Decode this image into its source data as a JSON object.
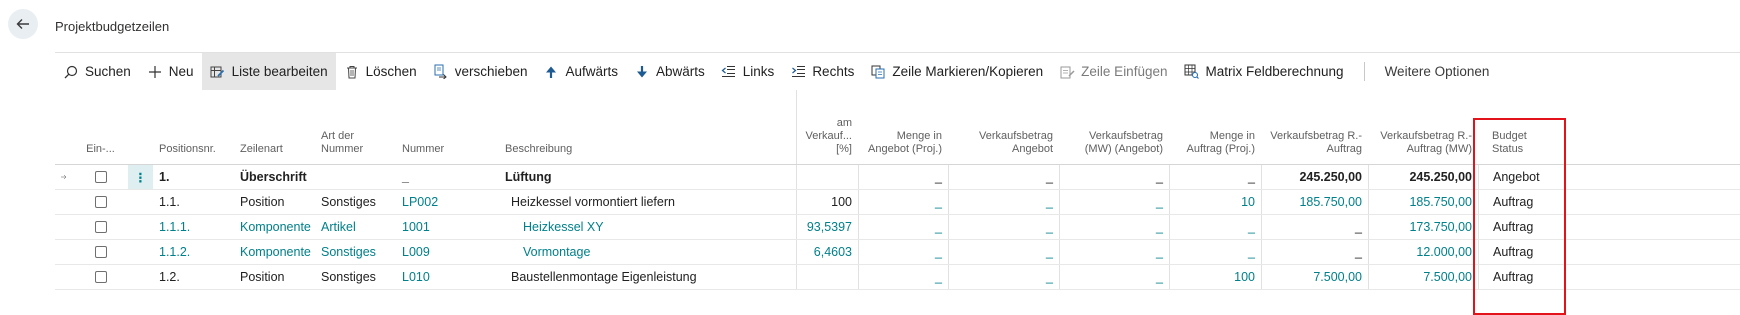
{
  "header": {
    "title": "Projektbudgetzeilen"
  },
  "toolbar": {
    "items": [
      {
        "label": "Suchen",
        "icon": "search-icon"
      },
      {
        "label": "Neu",
        "icon": "plus-icon"
      },
      {
        "label": "Liste bearbeiten",
        "icon": "edit-list-icon",
        "active": true
      },
      {
        "label": "Löschen",
        "icon": "trash-icon"
      },
      {
        "label": "verschieben",
        "icon": "move-icon"
      },
      {
        "label": "Aufwärts",
        "icon": "arrow-up-icon"
      },
      {
        "label": "Abwärts",
        "icon": "arrow-down-icon"
      },
      {
        "label": "Links",
        "icon": "outdent-icon"
      },
      {
        "label": "Rechts",
        "icon": "indent-icon"
      },
      {
        "label": "Zeile Markieren/Kopieren",
        "icon": "copy-icon"
      },
      {
        "label": "Zeile Einfügen",
        "icon": "paste-icon",
        "disabled": true
      },
      {
        "label": "Matrix Feldberechnung",
        "icon": "matrix-icon"
      }
    ],
    "more": "Weitere Optionen"
  },
  "table": {
    "columns": {
      "ein": "Ein-...",
      "pos": "Positionsnr.",
      "zeilenart": "Zeilenart",
      "art_line1": "Art der",
      "art_line2": "Nummer",
      "nummer": "Nummer",
      "beschreibung": "Beschreibung",
      "amv_line1": "am",
      "amv_line2": "Verkauf...",
      "amv_line3": "[%]",
      "m1_line1": "Menge in",
      "m1_line2": "Angebot (Proj.)",
      "v1_line1": "Verkaufsbetrag",
      "v1_line2": "Angebot",
      "v2_line1": "Verkaufsbetrag",
      "v2_line2": "(MW) (Angebot)",
      "m2_line1": "Menge in",
      "m2_line2": "Auftrag (Proj.)",
      "v3_line1": "Verkaufsbetrag R.-",
      "v3_line2": "Auftrag",
      "v4_line1": "Verkaufsbetrag R.-",
      "v4_line2": "Auftrag (MW)",
      "bs_line1": "Budget",
      "bs_line2": "Status"
    },
    "rows": [
      {
        "pos": "1.",
        "zeilenart": "Überschrift",
        "art": "",
        "nummer": "_",
        "beschreibung": "Lüftung",
        "amv": "",
        "m1": "_",
        "v1": "_",
        "v2": "_",
        "m2": "_",
        "v3": "245.250,00",
        "v4": "245.250,00",
        "status": "Angebot"
      },
      {
        "pos": "1.1.",
        "zeilenart": "Position",
        "art": "Sonstiges",
        "nummer": "LP002",
        "beschreibung": "Heizkessel vormontiert liefern",
        "amv": "100",
        "m1": "_",
        "v1": "_",
        "v2": "_",
        "m2": "10",
        "v3": "185.750,00",
        "v4": "185.750,00",
        "status": "Auftrag"
      },
      {
        "pos": "1.1.1.",
        "zeilenart": "Komponente",
        "art": "Artikel",
        "nummer": "1001",
        "beschreibung": "Heizkessel XY",
        "amv": "93,5397",
        "m1": "_",
        "v1": "_",
        "v2": "_",
        "m2": "_",
        "v3": "_",
        "v4": "173.750,00",
        "status": "Auftrag"
      },
      {
        "pos": "1.1.2.",
        "zeilenart": "Komponente",
        "art": "Sonstiges",
        "nummer": "L009",
        "beschreibung": "Vormontage",
        "amv": "6,4603",
        "m1": "_",
        "v1": "_",
        "v2": "_",
        "m2": "_",
        "v3": "_",
        "v4": "12.000,00",
        "status": "Auftrag"
      },
      {
        "pos": "1.2.",
        "zeilenart": "Position",
        "art": "Sonstiges",
        "nummer": "L010",
        "beschreibung": "Baustellenmontage Eigenleistung",
        "amv": "",
        "m1": "_",
        "v1": "_",
        "v2": "_",
        "m2": "100",
        "v3": "7.500,00",
        "v4": "7.500,00",
        "status": "Auftrag"
      }
    ]
  },
  "colors": {
    "accent": "#00808a",
    "highlight": "#e3131b",
    "toolbar_active": "#e6e6e6"
  }
}
